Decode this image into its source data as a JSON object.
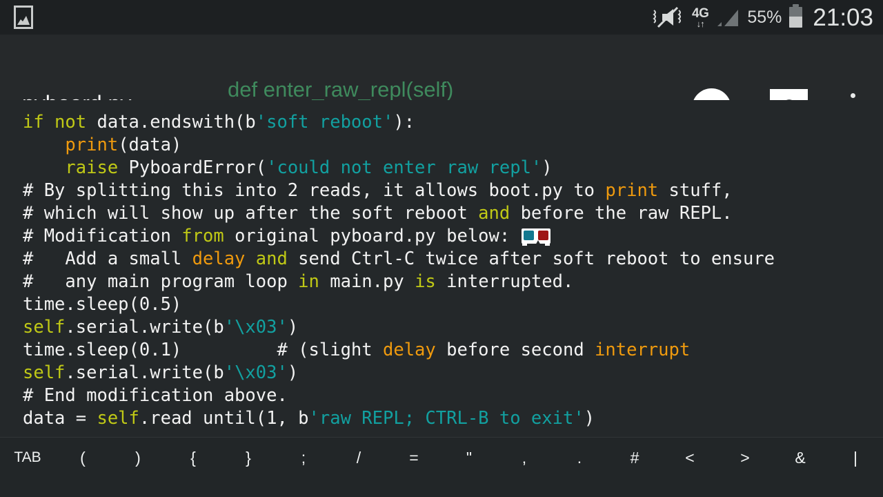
{
  "statusbar": {
    "notification_icon": "image-notification-icon",
    "icons": [
      {
        "name": "mute-vibrate-icon"
      },
      {
        "name": "network-4g-icon",
        "label": "4G",
        "arrows": "↓↑"
      },
      {
        "name": "signal-strength-icon"
      }
    ],
    "battery_percent": "55%",
    "battery_level": 55,
    "battery_icon": "battery-icon",
    "clock": "21:03"
  },
  "titlebar": {
    "file_name": "pyboard.py",
    "function_context": "def enter_raw_repl(self)",
    "run_label": "run-arrow-icon",
    "search_label": "search-icon",
    "overflow_label": "overflow-menu-icon"
  },
  "editor": {
    "language": "python",
    "colors": {
      "background": "#24282a",
      "plain": "#f2f2f2",
      "keyword": "#c0c916",
      "builtin": "#ef9a0e",
      "string": "#12a0a0",
      "function_context": "#3f8a5d"
    },
    "lines": [
      [
        {
          "t": "if not ",
          "c": "kw"
        },
        {
          "t": "data.endswith(b",
          "c": "plain"
        },
        {
          "t": "'soft reboot'",
          "c": "str"
        },
        {
          "t": "):",
          "c": "plain"
        }
      ],
      [
        {
          "t": "    ",
          "c": "plain"
        },
        {
          "t": "print",
          "c": "builtin"
        },
        {
          "t": "(data)",
          "c": "plain"
        }
      ],
      [
        {
          "t": "    ",
          "c": "plain"
        },
        {
          "t": "raise",
          "c": "kw"
        },
        {
          "t": " PyboardError(",
          "c": "plain"
        },
        {
          "t": "'could not enter raw repl'",
          "c": "str"
        },
        {
          "t": ")",
          "c": "plain"
        }
      ],
      [
        {
          "t": "# By splitting this into 2 reads, it allows boot.py to ",
          "c": "plain"
        },
        {
          "t": "print",
          "c": "builtin"
        },
        {
          "t": " stuff,",
          "c": "plain"
        }
      ],
      [
        {
          "t": "# which will show up after the soft reboot ",
          "c": "plain"
        },
        {
          "t": "and",
          "c": "kw"
        },
        {
          "t": " before the raw REPL.",
          "c": "plain"
        }
      ],
      [
        {
          "t": "# Modification ",
          "c": "plain"
        },
        {
          "t": "from",
          "c": "kw"
        },
        {
          "t": " original pyboard.py below: ",
          "c": "plain"
        },
        {
          "t": "🕶",
          "c": "emoji3d"
        }
      ],
      [
        {
          "t": "#   Add a small ",
          "c": "plain"
        },
        {
          "t": "delay",
          "c": "builtin"
        },
        {
          "t": " ",
          "c": "plain"
        },
        {
          "t": "and",
          "c": "kw"
        },
        {
          "t": " send Ctrl-C twice after soft reboot to ensure",
          "c": "plain"
        }
      ],
      [
        {
          "t": "#   any main program loop ",
          "c": "plain"
        },
        {
          "t": "in",
          "c": "kw"
        },
        {
          "t": " main.py ",
          "c": "plain"
        },
        {
          "t": "is",
          "c": "kw"
        },
        {
          "t": " interrupted.",
          "c": "plain"
        }
      ],
      [
        {
          "t": "time.sleep(0.5)",
          "c": "plain"
        }
      ],
      [
        {
          "t": "self",
          "c": "kw"
        },
        {
          "t": ".serial.write(b",
          "c": "plain"
        },
        {
          "t": "'\\x03'",
          "c": "str"
        },
        {
          "t": ")",
          "c": "plain"
        }
      ],
      [
        {
          "t": "time.sleep(0.1)         # (slight ",
          "c": "plain"
        },
        {
          "t": "delay",
          "c": "builtin"
        },
        {
          "t": " before second ",
          "c": "plain"
        },
        {
          "t": "interrupt",
          "c": "builtin"
        }
      ],
      [
        {
          "t": "self",
          "c": "kw"
        },
        {
          "t": ".serial.write(b",
          "c": "plain"
        },
        {
          "t": "'\\x03'",
          "c": "str"
        },
        {
          "t": ")",
          "c": "plain"
        }
      ],
      [
        {
          "t": "# End modification above.",
          "c": "plain"
        }
      ],
      [
        {
          "t": "data = ",
          "c": "plain"
        },
        {
          "t": "self",
          "c": "kw"
        },
        {
          "t": ".read until(1, b",
          "c": "plain"
        },
        {
          "t": "'raw REPL; CTRL-B to exit'",
          "c": "str"
        },
        {
          "t": ")",
          "c": "plain"
        }
      ]
    ]
  },
  "symbolbar": {
    "symbols": [
      {
        "name": "tab",
        "label": "TAB"
      },
      {
        "name": "paren-open",
        "label": "("
      },
      {
        "name": "paren-close",
        "label": ")"
      },
      {
        "name": "brace-open",
        "label": "{"
      },
      {
        "name": "brace-close",
        "label": "}"
      },
      {
        "name": "semicolon",
        "label": ";"
      },
      {
        "name": "slash",
        "label": "/"
      },
      {
        "name": "equals",
        "label": "="
      },
      {
        "name": "quote",
        "label": "\""
      },
      {
        "name": "comma",
        "label": ","
      },
      {
        "name": "period",
        "label": "."
      },
      {
        "name": "hash",
        "label": "#"
      },
      {
        "name": "less-than",
        "label": "<"
      },
      {
        "name": "greater-than",
        "label": ">"
      },
      {
        "name": "ampersand",
        "label": "&"
      },
      {
        "name": "pipe",
        "label": "|"
      }
    ]
  }
}
